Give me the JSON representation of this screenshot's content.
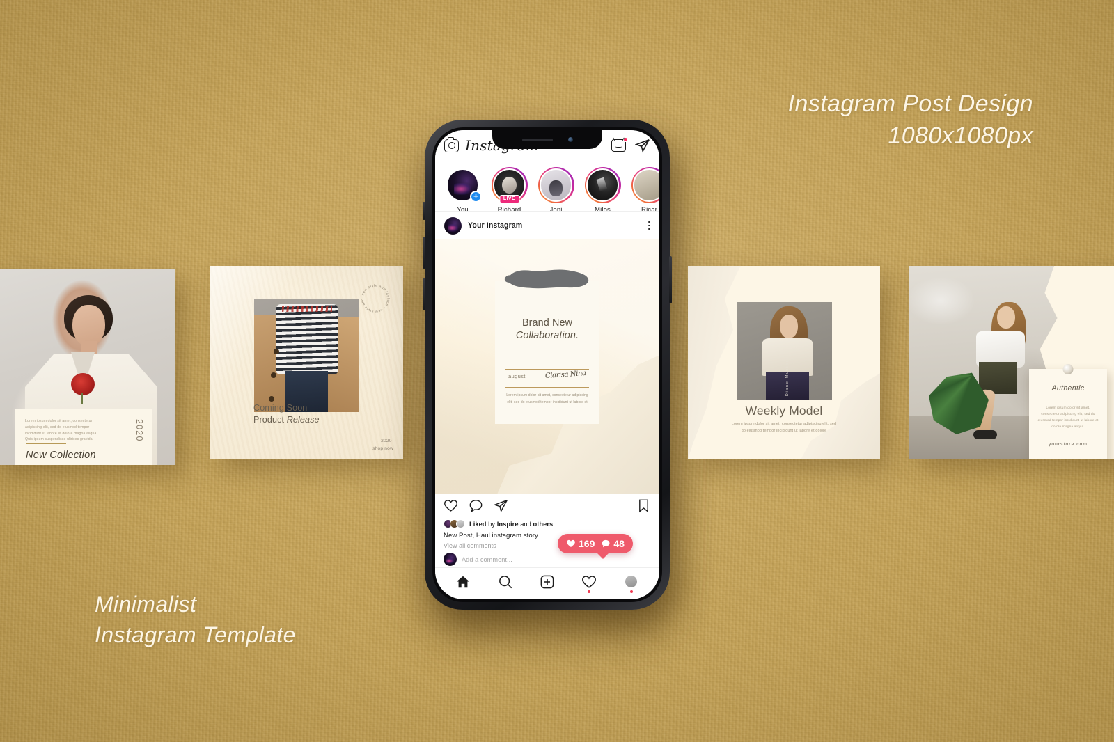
{
  "canvas": {
    "headline_right_line1": "Instagram Post Design",
    "headline_right_line2": "1080x1080px",
    "headline_left_line1": "Minimalist",
    "headline_left_line2": "Instagram Template",
    "background_color": "#c9a758",
    "text_color": "#fdf6e6"
  },
  "cards": {
    "new_collection": {
      "lorem": "Lorem ipsum dolor sit amet, consectetur adipiscing elit, sed do eiusmod tempor incididunt ut labore et dolore magna aliqua. Quis ipsum suspendisse ultrices gravida.",
      "year": "2020",
      "title": "New Collection",
      "accent": "#b79a58"
    },
    "coming_soon": {
      "title_line1": "Coming Soon",
      "title_line2_regular": "Product ",
      "title_line2_italic": "Release",
      "circular_text": "new style and fashion · new style and fashion ·",
      "footer_line1": "-2020-",
      "footer_line2": "shop now"
    },
    "weekly_model": {
      "vertical_name": "Diane Mustard",
      "title": "Weekly Model",
      "lorem": "Lorem ipsum dolor sit amet, consectetur adipiscing elit, sed do eiusmod tempor incididunt ut labore et dolore"
    },
    "authentic": {
      "title": "Authentic",
      "lorem": "Lorem ipsum dolor sit amet, consectetur adipiscing elit, sed do eiusmod tempor incididunt ut labore et dolore magna aliqua.",
      "url": "yourstore.com"
    }
  },
  "phone": {
    "header": {
      "camera_icon": "camera-icon",
      "wordmark": "Instagram",
      "igtv_icon": "igtv-icon",
      "send_icon": "direct-message-icon"
    },
    "stories": [
      {
        "name": "You",
        "ring": "none",
        "badge": "plus"
      },
      {
        "name": "Richard",
        "ring": "gradient",
        "badge": "LIVE"
      },
      {
        "name": "Joni",
        "ring": "gradient",
        "badge": ""
      },
      {
        "name": "Milos",
        "ring": "gradient",
        "badge": ""
      },
      {
        "name": "Ricar",
        "ring": "gradient",
        "badge": ""
      }
    ],
    "post": {
      "author": "Your Instagram",
      "menu_icon": "more-options-icon",
      "image": {
        "title_line1": "Brand New",
        "title_line2": "Collaboration.",
        "month": "august",
        "signature": "Clarisa Nina",
        "lorem": "Lorem ipsum dolor sit amet, consectetur adipiscing elit, sed do eiusmod tempor incididunt ut labore et"
      },
      "actions": {
        "like_icon": "heart-icon",
        "comment_icon": "comment-icon",
        "share_icon": "share-icon",
        "save_icon": "bookmark-icon"
      },
      "liked_prefix": "Liked",
      "liked_by": " by ",
      "liked_name": "Inspire",
      "liked_suffix": " and ",
      "liked_others": "others",
      "caption": "New Post, Haul instagram story...",
      "view_comments": "View all comments",
      "comment_placeholder": "Add a comment..."
    },
    "badge": {
      "likes": "169",
      "comments": "48",
      "color": "#ef5a6b"
    },
    "nav": [
      {
        "name": "home-icon",
        "dot": false
      },
      {
        "name": "search-icon",
        "dot": false
      },
      {
        "name": "add-post-icon",
        "dot": false
      },
      {
        "name": "activity-icon",
        "dot": true
      },
      {
        "name": "profile-icon",
        "dot": true
      }
    ]
  }
}
